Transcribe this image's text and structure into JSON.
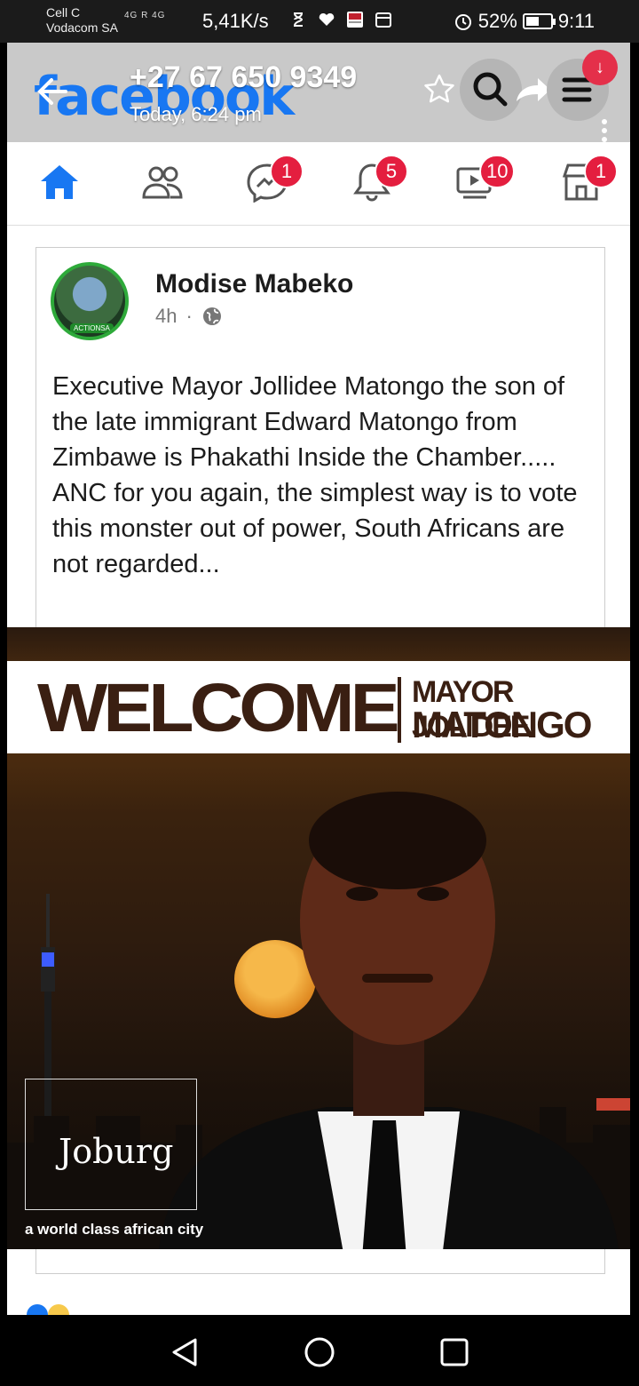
{
  "status_bar": {
    "carrier_line1": "Cell C",
    "carrier_line2": "Vodacom SA",
    "network_labels": "4G R  4G",
    "speed": "5,41K/s",
    "battery_text": "52%",
    "battery_level": 0.52,
    "time": "9:11",
    "icons": [
      "hourglass-icon",
      "heart-icon",
      "news-app-icon",
      "calendar-icon",
      "alarm-icon",
      "battery-icon"
    ]
  },
  "header": {
    "logo_text": "facebook",
    "phone_number": "+27 67 650 9349",
    "timestamp": "Today, 6:24 pm",
    "download_badge": "↓",
    "brand_color": "#1877f2"
  },
  "nav": {
    "items": [
      {
        "name": "home",
        "icon": "home-icon",
        "badge": ""
      },
      {
        "name": "friends",
        "icon": "friends-icon",
        "badge": ""
      },
      {
        "name": "messenger",
        "icon": "messenger-icon",
        "badge": "1"
      },
      {
        "name": "notifications",
        "icon": "bell-icon",
        "badge": "5"
      },
      {
        "name": "watch",
        "icon": "video-icon",
        "badge": "10"
      },
      {
        "name": "marketplace",
        "icon": "shop-icon",
        "badge": "1"
      }
    ],
    "badge_color": "#e41e3f"
  },
  "post": {
    "author": "Modise Mabeko",
    "time": "4h",
    "dot": "·",
    "avatar_tag": "ACTIONSA",
    "text": "Executive Mayor Jollidee Matongo the son of the late immigrant Edward Matongo from Zimbawe is Phakathi Inside the Chamber..... ANC for you again, the simplest way is to vote this monster out of power, South Africans are not regarded..."
  },
  "post_image": {
    "welcome": "WELCOME",
    "mayor_line1": "MAYOR JOLIDEE",
    "mayor_line2": "MATONGO",
    "logo": "Joburg",
    "tagline": "a world class african city"
  }
}
